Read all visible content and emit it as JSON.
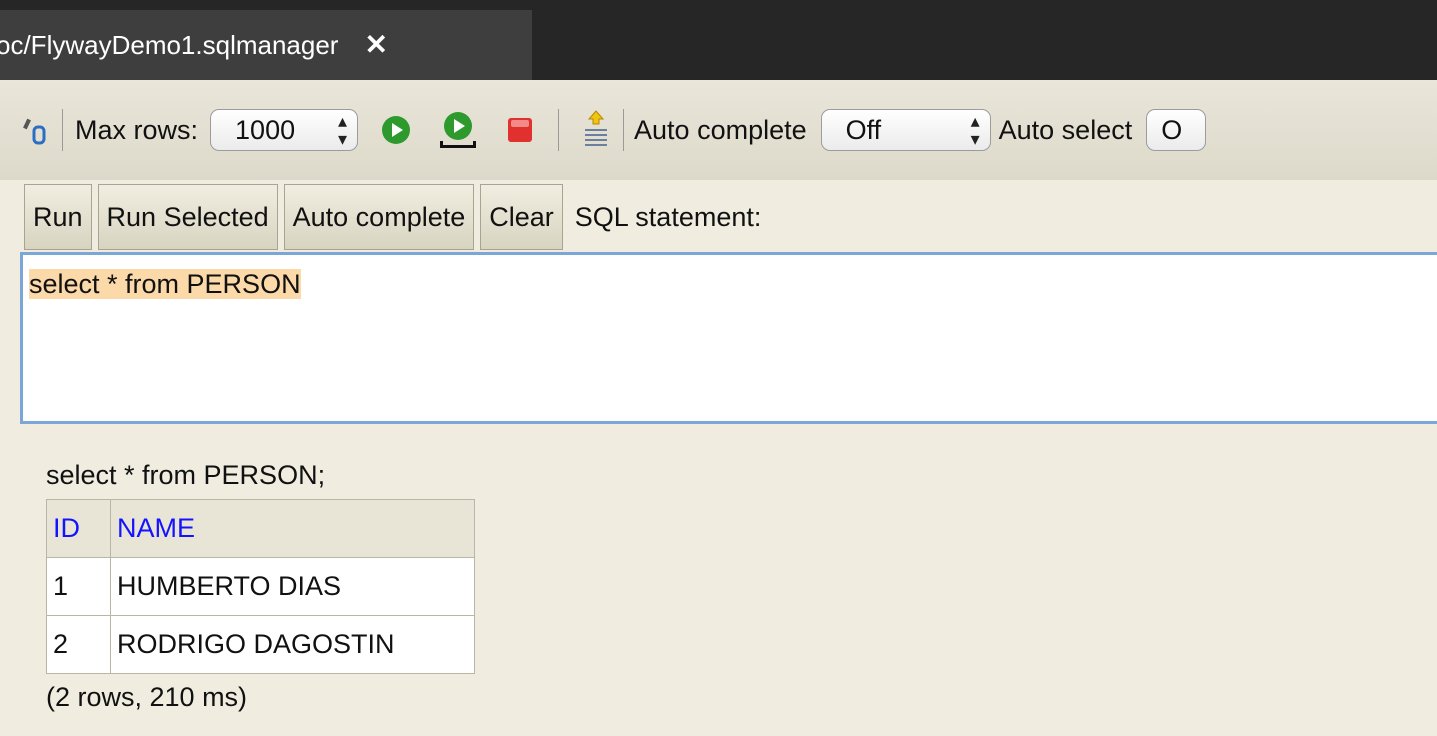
{
  "tab": {
    "title": "oc/FlywayDemo1.sqlmanager",
    "close": "✕"
  },
  "toolbar": {
    "max_rows_label": "Max rows:",
    "max_rows_value": "1000",
    "auto_complete_label": "Auto complete",
    "auto_complete_value": "Off",
    "auto_select_label": "Auto select",
    "auto_select_value": "O"
  },
  "buttons": {
    "run": "Run",
    "run_selected": "Run Selected",
    "auto_complete": "Auto complete",
    "clear": "Clear",
    "sql_statement_label": "SQL statement:"
  },
  "editor": {
    "text": "select * from PERSON"
  },
  "results": {
    "statement": "select * from PERSON;",
    "columns": [
      "ID",
      "NAME"
    ],
    "rows": [
      [
        "1",
        "HUMBERTO DIAS"
      ],
      [
        "2",
        "RODRIGO DAGOSTIN"
      ]
    ],
    "summary": "(2 rows, 210 ms)"
  },
  "colors": {
    "tab_bar": "#262626",
    "active_tab": "#3e3e3e",
    "background": "#f0ede0",
    "header_text": "#1313ff",
    "editor_border": "#7ba7d8",
    "highlight": "#fcd9a8",
    "run_green": "#2e9a2e",
    "stop_red": "#e0312f"
  }
}
